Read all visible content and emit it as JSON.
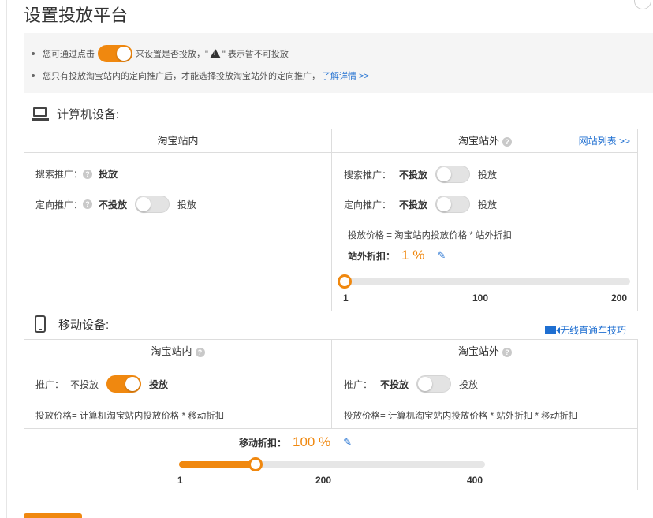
{
  "page": {
    "title": "设置投放平台"
  },
  "notice": {
    "line1_prefix": "您可通过点击",
    "line1_mid": "来设置是否投放，\"",
    "line1_suffix": "\" 表示暂不可投放",
    "line2_text": "您只有投放淘宝站内的定向推广后，才能选择投放淘宝站外的定向推广，",
    "line2_link": "了解详情 >>"
  },
  "pc": {
    "title": "计算机设备:",
    "inside": {
      "header": "淘宝站内",
      "search_label": "搜索推广：",
      "search_value": "投放",
      "targeted_label": "定向推广：",
      "targeted_off": "不投放",
      "targeted_on": "投放",
      "targeted_enabled": false
    },
    "outside": {
      "header": "淘宝站外",
      "site_list_link": "网站列表 >>",
      "search_label": "搜索推广：",
      "search_off": "不投放",
      "search_on": "投放",
      "search_enabled": false,
      "targeted_label": "定向推广：",
      "targeted_off": "不投放",
      "targeted_on": "投放",
      "targeted_enabled": false,
      "price_formula": "投放价格 = 淘宝站内投放价格 * 站外折扣",
      "discount_label": "站外折扣：",
      "discount_value": "1 %",
      "slider": {
        "min": 1,
        "max": 200,
        "value": 1,
        "ticks": [
          "1",
          "100",
          "200"
        ]
      }
    }
  },
  "mobile": {
    "title": "移动设备:",
    "video_link": "无线直通车技巧",
    "inside": {
      "header": "淘宝站内",
      "promo_label": "推广：",
      "off": "不投放",
      "on": "投放",
      "enabled": true,
      "price_formula": "投放价格= 计算机淘宝站内投放价格 * 移动折扣"
    },
    "outside": {
      "header": "淘宝站外",
      "promo_label": "推广：",
      "off": "不投放",
      "on": "投放",
      "enabled": false,
      "price_formula": "投放价格= 计算机淘宝站内投放价格 * 站外折扣 * 移动折扣"
    },
    "discount_label": "移动折扣：",
    "discount_value": "100 %",
    "slider": {
      "min": 1,
      "max": 400,
      "value": 100,
      "ticks": [
        "1",
        "200",
        "400"
      ]
    }
  },
  "colors": {
    "accent": "#f0880f",
    "link": "#1f6fd1"
  },
  "icons": [
    "computer-icon",
    "phone-icon",
    "help-icon",
    "warning-icon",
    "pencil-icon",
    "video-icon",
    "close-icon"
  ]
}
